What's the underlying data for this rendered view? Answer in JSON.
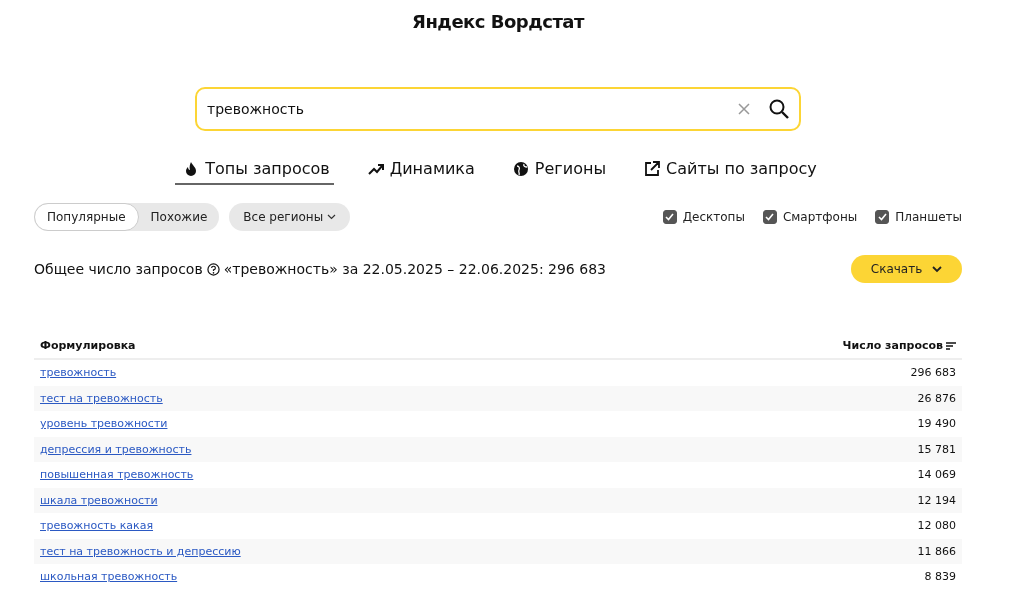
{
  "header": {
    "title": "Яндекс Вордстат"
  },
  "search": {
    "value": "тревожность"
  },
  "tabs": [
    {
      "label": "Топы запросов",
      "kind": "flame",
      "selected": true
    },
    {
      "label": "Динамика",
      "kind": "trend",
      "selected": false
    },
    {
      "label": "Регионы",
      "kind": "globe",
      "selected": false
    },
    {
      "label": "Сайты по запросу",
      "kind": "external",
      "selected": false
    }
  ],
  "mode_switch": [
    {
      "label": "Популярные",
      "selected": true
    },
    {
      "label": "Похожие",
      "selected": false
    }
  ],
  "region_dropdown": {
    "label": "Все регионы"
  },
  "devices": [
    {
      "label": "Десктопы",
      "checked": true
    },
    {
      "label": "Смартфоны",
      "checked": true
    },
    {
      "label": "Планшеты",
      "checked": true
    }
  ],
  "summary": {
    "label": "Общее число запросов",
    "text": "«тревожность» за 22.05.2025 – 22.06.2025: 296 683"
  },
  "download_button": {
    "label": "Скачать"
  },
  "table": {
    "columns": [
      "Формулировка",
      "Число запросов"
    ],
    "rows": [
      {
        "phrase": "тревожность",
        "count": "296 683"
      },
      {
        "phrase": "тест на тревожность",
        "count": "26 876"
      },
      {
        "phrase": "уровень тревожности",
        "count": "19 490"
      },
      {
        "phrase": "депрессия и тревожность",
        "count": "15 781"
      },
      {
        "phrase": "повышенная тревожность",
        "count": "14 069"
      },
      {
        "phrase": "шкала тревожности",
        "count": "12 194"
      },
      {
        "phrase": "тревожность какая",
        "count": "12 080"
      },
      {
        "phrase": "тест на тревожность и депрессию",
        "count": "11 866"
      },
      {
        "phrase": "школьная тревожность",
        "count": "8 839"
      }
    ]
  }
}
